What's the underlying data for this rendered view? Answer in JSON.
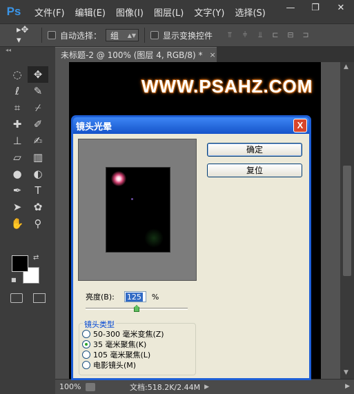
{
  "app": {
    "logo": "Ps"
  },
  "menu": [
    "文件(F)",
    "编辑(E)",
    "图像(I)",
    "图层(L)",
    "文字(Y)",
    "选择(S)"
  ],
  "window_controls": {
    "minimize": "—",
    "restore": "❐",
    "close": "✕"
  },
  "options_bar": {
    "auto_select_label": "自动选择：",
    "auto_select_value": "组",
    "show_transform_label": "显示变换控件"
  },
  "document": {
    "tab_title": "未标题-2 @ 100% (图层 4, RGB/8) *",
    "tab_close": "×",
    "banner_text": "WWW.PSAHZ.COM"
  },
  "status": {
    "zoom": "100%",
    "doc_info": "文档:518.2K/2.44M"
  },
  "dialog": {
    "title": "镜头光晕",
    "close": "X",
    "ok_label": "确定",
    "reset_label": "复位",
    "brightness_label": "亮度(B):",
    "brightness_value": "125",
    "brightness_unit": "%",
    "brightness_slider_fraction": 0.5,
    "lens_type_legend": "镜头类型",
    "lens_types": [
      {
        "label": "50-300 毫米变焦(Z)",
        "selected": false
      },
      {
        "label": "35 毫米聚焦(K)",
        "selected": true
      },
      {
        "label": "105 毫米聚焦(L)",
        "selected": false
      },
      {
        "label": "电影镜头(M)",
        "selected": false
      }
    ]
  },
  "colors": {
    "foreground": "#000000",
    "background": "#ffffff",
    "dialog_frame": "#1e5fd6",
    "dialog_body": "#ece9d8",
    "close_button": "#d8462b"
  },
  "icons": {
    "tools": [
      "marquee-icon",
      "move-icon",
      "lasso-icon",
      "quick-select-icon",
      "crop-icon",
      "eyedropper-icon",
      "healing-icon",
      "brush-icon",
      "stamp-icon",
      "history-brush-icon",
      "eraser-icon",
      "gradient-icon",
      "blur-icon",
      "dodge-icon",
      "pen-icon",
      "type-icon",
      "path-select-icon",
      "shape-icon",
      "hand-icon",
      "zoom-icon"
    ]
  }
}
